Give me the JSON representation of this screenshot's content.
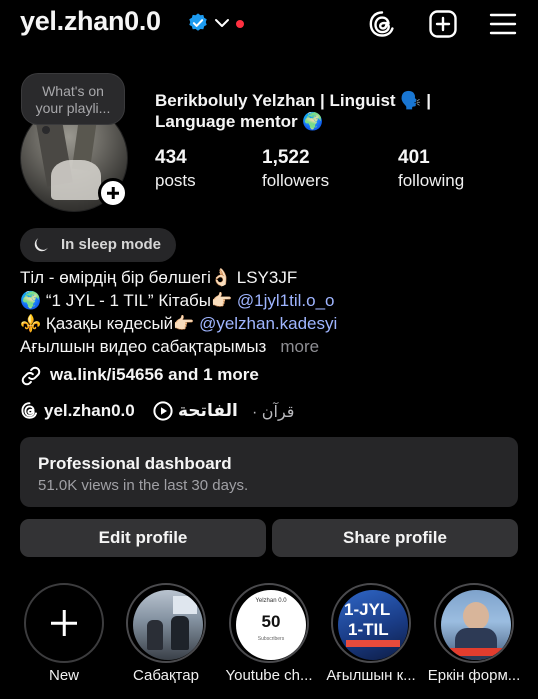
{
  "header": {
    "username": "yel.zhan0.0",
    "verified_icon": "verified-badge-icon",
    "has_notification_dot": true,
    "accent_verified": "#1d9bf0",
    "notification_color": "#ff3040"
  },
  "note": {
    "line1": "What's on",
    "line2": "your playli..."
  },
  "profile": {
    "full_name": "Berikboluly Yelzhan | Linguist 🗣️ | Language mentor 🌍",
    "stats": [
      {
        "value": "434",
        "label": "posts"
      },
      {
        "value": "1,522",
        "label": "followers"
      },
      {
        "value": "401",
        "label": "following"
      }
    ]
  },
  "status": {
    "sleep_mode": "In sleep mode"
  },
  "bio": {
    "line1": "Тіл - өмірдің бір бөлшегі👌🏻 LSY3JF",
    "line2_prefix": "🌍 “1 JYL - 1 TIL” Кітабы👉🏻 ",
    "line2_mention": "@1jyl1til.o_o",
    "line3_prefix": "⚜️ Қазақы кәдесый👉🏻 ",
    "line3_mention": "@yelzhan.kadesyi",
    "line4": "Ағылшын видео сабақтарымыз",
    "more": "more"
  },
  "link": {
    "text": "wa.link/i54656 and 1 more"
  },
  "threads": {
    "username": "yel.zhan0.0",
    "song": "الفاتحة",
    "separator": "·",
    "artist": "قرآن"
  },
  "dashboard": {
    "title": "Professional dashboard",
    "subtitle": "51.0K views in the last 30 days."
  },
  "actions": {
    "edit": "Edit profile",
    "share": "Share profile"
  },
  "highlights": [
    {
      "label": "New"
    },
    {
      "label": "Сабақтар"
    },
    {
      "label": "Youtube ch..."
    },
    {
      "label": "Ағылшын к..."
    },
    {
      "label": "Еркін форм..."
    }
  ],
  "highlight_thumbs": {
    "youtube_head": "Yelzhan 0.0",
    "youtube_num": "50",
    "youtube_sub": "Subscribers",
    "jyl_line1": "1-JYL",
    "jyl_line2": "1-TIL"
  }
}
